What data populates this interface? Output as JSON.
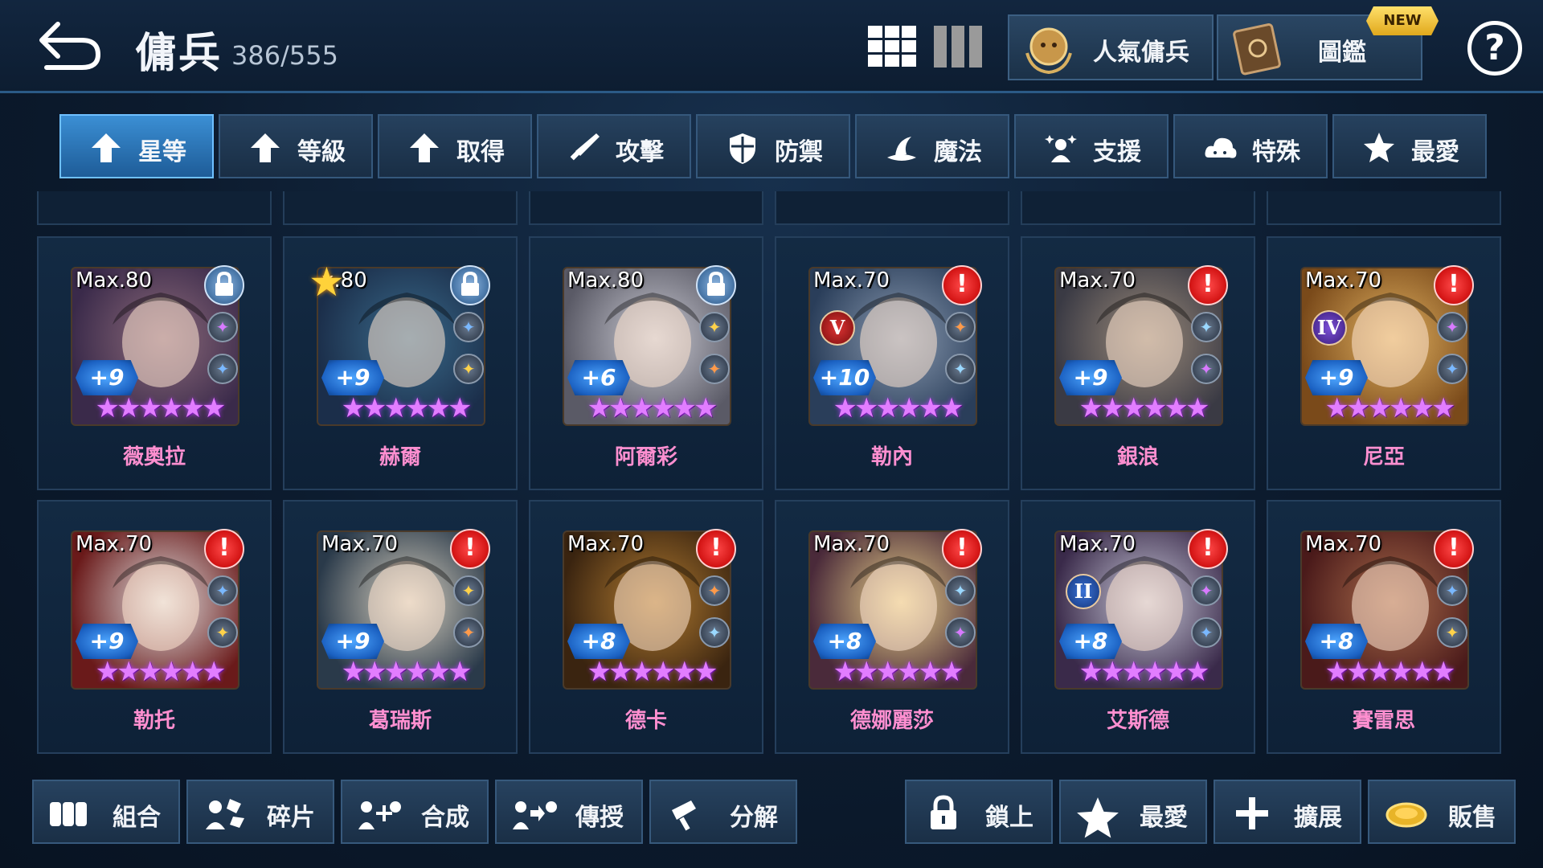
{
  "header": {
    "title": "傭兵",
    "count": "386/555",
    "popular_label": "人氣傭兵",
    "codex_label": "圖鑑",
    "new_badge": "NEW",
    "help": "?"
  },
  "tabs": [
    {
      "label": "星等",
      "icon": "arrow-up-icon",
      "active": true
    },
    {
      "label": "等級",
      "icon": "arrow-up-icon",
      "active": false
    },
    {
      "label": "取得",
      "icon": "arrow-up-icon",
      "active": false
    },
    {
      "label": "攻擊",
      "icon": "sword-icon",
      "active": false
    },
    {
      "label": "防禦",
      "icon": "shield-icon",
      "active": false
    },
    {
      "label": "魔法",
      "icon": "hat-icon",
      "active": false
    },
    {
      "label": "支援",
      "icon": "support-icon",
      "active": false
    },
    {
      "label": "特殊",
      "icon": "cloud-icon",
      "active": false
    },
    {
      "label": "最愛",
      "icon": "star-icon",
      "active": false
    }
  ],
  "cards": [
    {
      "name": "薇奧拉",
      "max": "Max.80",
      "plus": "+9",
      "badge": "lock",
      "tier": "",
      "fav": false,
      "colors": [
        "#3a2a4a",
        "#8c6a7a"
      ]
    },
    {
      "name": "赫爾",
      "max": "x.80",
      "plus": "+9",
      "badge": "lock",
      "tier": "",
      "fav": true,
      "colors": [
        "#1b2e4a",
        "#3a6a8a"
      ]
    },
    {
      "name": "阿爾彩",
      "max": "Max.80",
      "plus": "+6",
      "badge": "lock",
      "tier": "",
      "fav": false,
      "colors": [
        "#5a5a66",
        "#c9c9d2"
      ]
    },
    {
      "name": "勒內",
      "max": "Max.70",
      "plus": "+10",
      "badge": "alert",
      "tier": "V",
      "fav": false,
      "colors": [
        "#2a3e5a",
        "#8a9ab0"
      ]
    },
    {
      "name": "銀浪",
      "max": "Max.70",
      "plus": "+9",
      "badge": "alert",
      "tier": "",
      "fav": false,
      "colors": [
        "#3a3a44",
        "#9a8a7a"
      ]
    },
    {
      "name": "尼亞",
      "max": "Max.70",
      "plus": "+9",
      "badge": "alert",
      "tier": "IV",
      "fav": false,
      "colors": [
        "#7a4a1a",
        "#e0b060"
      ]
    },
    {
      "name": "勒托",
      "max": "Max.70",
      "plus": "+9",
      "badge": "alert",
      "tier": "",
      "fav": false,
      "colors": [
        "#6a1a1a",
        "#e0e0e0"
      ]
    },
    {
      "name": "葛瑞斯",
      "max": "Max.70",
      "plus": "+9",
      "badge": "alert",
      "tier": "",
      "fav": false,
      "colors": [
        "#2a3a4a",
        "#d8d0c0"
      ]
    },
    {
      "name": "德卡",
      "max": "Max.70",
      "plus": "+8",
      "badge": "alert",
      "tier": "",
      "fav": false,
      "colors": [
        "#3a2410",
        "#b07a30"
      ]
    },
    {
      "name": "德娜麗莎",
      "max": "Max.70",
      "plus": "+8",
      "badge": "alert",
      "tier": "",
      "fav": false,
      "colors": [
        "#4a2a3a",
        "#e8d08a"
      ]
    },
    {
      "name": "艾斯德",
      "max": "Max.70",
      "plus": "+8",
      "badge": "alert",
      "tier": "II",
      "fav": false,
      "colors": [
        "#3a2a4a",
        "#c8c8d8"
      ]
    },
    {
      "name": "賽雷思",
      "max": "Max.70",
      "plus": "+8",
      "badge": "alert",
      "tier": "",
      "fav": false,
      "colors": [
        "#4a1a1a",
        "#a86a4a"
      ]
    }
  ],
  "stars_glyph": "★★★★★★",
  "bottom": [
    {
      "label": "組合",
      "icon": "combo-icon"
    },
    {
      "label": "碎片",
      "icon": "fragment-icon"
    },
    {
      "label": "合成",
      "icon": "merge-icon"
    },
    {
      "label": "傳授",
      "icon": "transfer-icon"
    },
    {
      "label": "分解",
      "icon": "disassemble-icon"
    },
    {
      "label": "鎖上",
      "icon": "lock-icon"
    },
    {
      "label": "最愛",
      "icon": "star-icon"
    },
    {
      "label": "擴展",
      "icon": "plus-icon"
    },
    {
      "label": "販售",
      "icon": "coin-icon"
    }
  ]
}
